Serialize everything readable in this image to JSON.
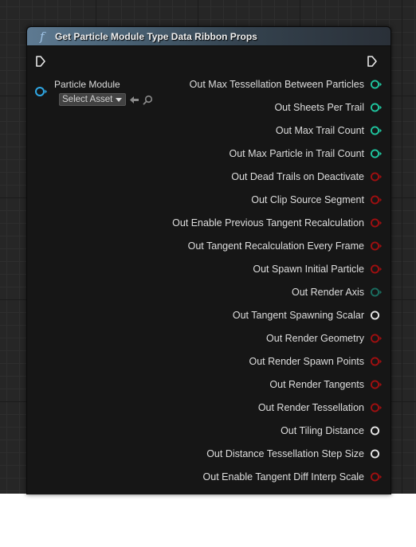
{
  "node": {
    "title": "Get Particle Module Type Data Ribbon Props",
    "title_icon": "function-icon"
  },
  "input": {
    "label": "Particle Module",
    "asset_picker_value": "Select Asset",
    "pin_color": "#2fa8e6"
  },
  "outputs": [
    {
      "label": "Out Max Tessellation Between Particles",
      "pin": "int",
      "color": "#1fc7a0"
    },
    {
      "label": "Out Sheets Per Trail",
      "pin": "int",
      "color": "#1fc7a0"
    },
    {
      "label": "Out Max Trail Count",
      "pin": "int",
      "color": "#1fc7a0"
    },
    {
      "label": "Out Max Particle in Trail Count",
      "pin": "int",
      "color": "#1fc7a0"
    },
    {
      "label": "Out Dead Trails on Deactivate",
      "pin": "bool",
      "color": "#a10f10"
    },
    {
      "label": "Out Clip Source Segment",
      "pin": "bool",
      "color": "#a10f10"
    },
    {
      "label": "Out Enable Previous Tangent Recalculation",
      "pin": "bool",
      "color": "#a10f10"
    },
    {
      "label": "Out Tangent Recalculation Every Frame",
      "pin": "bool",
      "color": "#a10f10"
    },
    {
      "label": "Out Spawn Initial Particle",
      "pin": "bool",
      "color": "#a10f10"
    },
    {
      "label": "Out Render Axis",
      "pin": "byte",
      "color": "#1a6e61"
    },
    {
      "label": "Out Tangent Spawning Scalar",
      "pin": "float",
      "color": "#e8e8e8"
    },
    {
      "label": "Out Render Geometry",
      "pin": "bool",
      "color": "#a10f10"
    },
    {
      "label": "Out Render Spawn Points",
      "pin": "bool",
      "color": "#a10f10"
    },
    {
      "label": "Out Render Tangents",
      "pin": "bool",
      "color": "#a10f10"
    },
    {
      "label": "Out Render Tessellation",
      "pin": "bool",
      "color": "#a10f10"
    },
    {
      "label": "Out Tiling Distance",
      "pin": "float",
      "color": "#e8e8e8"
    },
    {
      "label": "Out Distance Tessellation Step Size",
      "pin": "float",
      "color": "#e8e8e8"
    },
    {
      "label": "Out Enable Tangent Diff Interp Scale",
      "pin": "bool",
      "color": "#a10f10"
    }
  ]
}
